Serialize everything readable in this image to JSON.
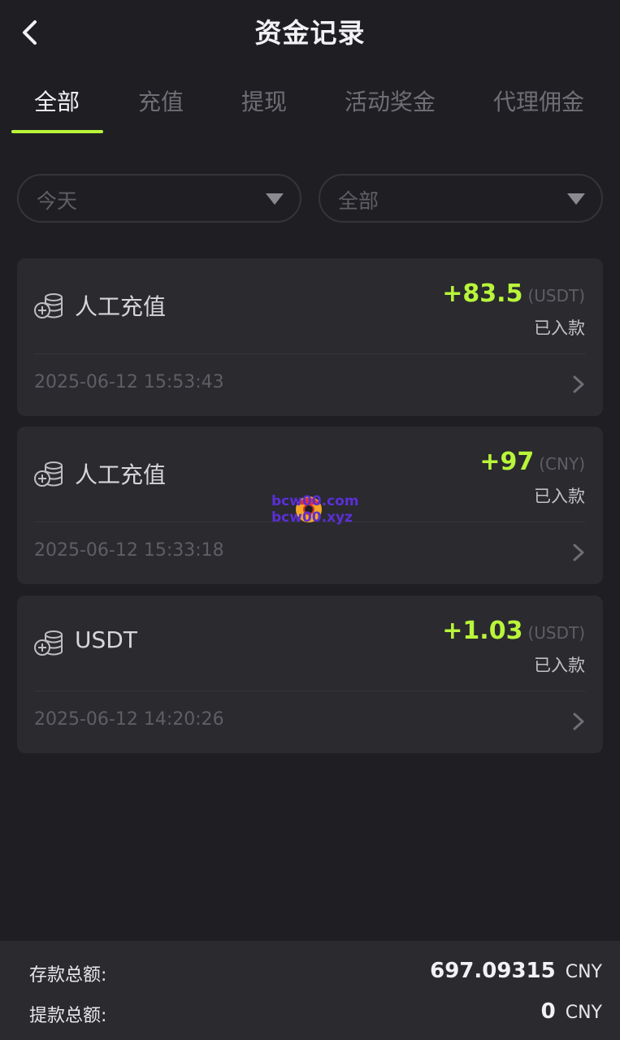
{
  "header": {
    "title": "资金记录",
    "back_icon": "chevron-left-icon"
  },
  "tabs": [
    {
      "label": "全部",
      "active": true
    },
    {
      "label": "充值",
      "active": false
    },
    {
      "label": "提现",
      "active": false
    },
    {
      "label": "活动奖金",
      "active": false
    },
    {
      "label": "代理佣金",
      "active": false
    }
  ],
  "filters": {
    "date": {
      "value": "今天"
    },
    "type": {
      "value": "全部"
    }
  },
  "records": [
    {
      "type": "人工充值",
      "amount": "+83.5",
      "currency": "(USDT)",
      "status": "已入款",
      "time": "2025-06-12 15:53:43"
    },
    {
      "type": "人工充值",
      "amount": "+97",
      "currency": "(CNY)",
      "status": "已入款",
      "time": "2025-06-12 15:33:18"
    },
    {
      "type": "USDT",
      "amount": "+1.03",
      "currency": "(USDT)",
      "status": "已入款",
      "time": "2025-06-12 14:20:26"
    }
  ],
  "watermark": {
    "line1": "bcw00.com",
    "line2": "bcw00.xyz"
  },
  "footer": {
    "deposit_label": "存款总额:",
    "deposit_value": "697.09315",
    "deposit_currency": "CNY",
    "withdraw_label": "提款总额:",
    "withdraw_value": "0",
    "withdraw_currency": "CNY"
  },
  "colors": {
    "accent": "#b9f53a",
    "background": "#1f1f23",
    "card": "#2a2a2f"
  }
}
